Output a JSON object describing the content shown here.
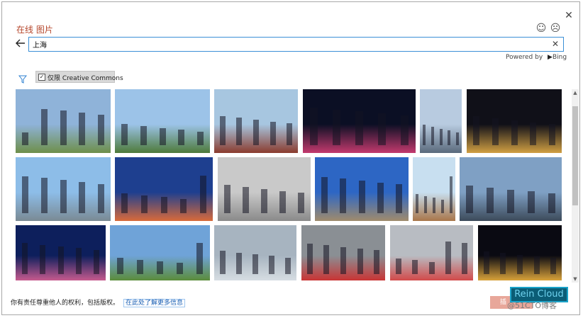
{
  "dialog": {
    "title": "在线 图片",
    "close_icon": "close-icon",
    "feedback_happy_icon": "smiley-icon",
    "feedback_sad_icon": "frown-icon"
  },
  "search": {
    "back_icon": "back-arrow-icon",
    "value": "上海",
    "clear_icon": "clear-icon"
  },
  "powered_by": {
    "label": "Powered by",
    "brand": "Bing"
  },
  "filter": {
    "icon": "filter-icon",
    "creative_commons_label": "仅限 Creative Commons",
    "creative_commons_checked": true
  },
  "results": {
    "items": [
      {
        "name": "disney-castle-photo",
        "colors": [
          "#8fb3d9",
          "#6e8f4a"
        ]
      },
      {
        "name": "disney-castle-photo-2",
        "colors": [
          "#9cc3e8",
          "#4d7a3a"
        ]
      },
      {
        "name": "red-brick-building-photo",
        "colors": [
          "#a7c6e0",
          "#8b3b2e"
        ]
      },
      {
        "name": "night-skyline-photo",
        "colors": [
          "#0b0f24",
          "#c33a6e"
        ]
      },
      {
        "name": "skyscraper-closeup-photo",
        "colors": [
          "#b8cbe0",
          "#5a6a7c"
        ]
      },
      {
        "name": "pearl-tower-night-photo",
        "colors": [
          "#101018",
          "#d1a043"
        ]
      },
      {
        "name": "pudong-skyline-day-photo",
        "colors": [
          "#8dbde8",
          "#7a8a94"
        ]
      },
      {
        "name": "pearl-tower-dusk-photo",
        "colors": [
          "#1e3f8f",
          "#d86a3a"
        ]
      },
      {
        "name": "metro-train-photo",
        "colors": [
          "#c9c9c9",
          "#8a8a8a"
        ]
      },
      {
        "name": "bund-building-photo",
        "colors": [
          "#2d66c4",
          "#a08b6c"
        ]
      },
      {
        "name": "clock-tower-photo",
        "colors": [
          "#c8dff0",
          "#a9764a"
        ]
      },
      {
        "name": "pudong-skyline-cloudy-photo",
        "colors": [
          "#7fa0c4",
          "#3c4a5a"
        ]
      },
      {
        "name": "skyline-night-blue-photo",
        "colors": [
          "#0d1f5c",
          "#c65a8e"
        ]
      },
      {
        "name": "stadium-photo",
        "colors": [
          "#6fa3d8",
          "#5b8c3a"
        ]
      },
      {
        "name": "metro-train-platform-photo",
        "colors": [
          "#a7b4c0",
          "#d6dde2"
        ]
      },
      {
        "name": "red-metro-train-photo",
        "colors": [
          "#8a8f94",
          "#c93434"
        ]
      },
      {
        "name": "metro-station-photo",
        "colors": [
          "#b8bcc2",
          "#d24a4a"
        ]
      },
      {
        "name": "bund-night-photo",
        "colors": [
          "#0a0a12",
          "#d9a23a"
        ]
      },
      {
        "name": "partial-photo-1",
        "colors": [
          "#e0e4ea",
          "#c9d3de"
        ]
      },
      {
        "name": "partial-photo-2",
        "colors": [
          "#dcdcdc",
          "#bcbcbc"
        ]
      },
      {
        "name": "partial-photo-3",
        "colors": [
          "#d7e8f6",
          "#aac6e0"
        ]
      },
      {
        "name": "partial-photo-4",
        "colors": [
          "#cfe0ef",
          "#9bb8d6"
        ]
      },
      {
        "name": "partial-photo-5",
        "colors": [
          "#3a6cc8",
          "#3a6cc8"
        ]
      },
      {
        "name": "partial-photo-6",
        "colors": [
          "#d8d2c8",
          "#b9b1a4"
        ]
      }
    ],
    "selected_index": 7
  },
  "footer": {
    "notice": "你有责任尊重他人的权利，包括版权。",
    "learn_more": "在此处了解更多信息",
    "insert_label": "插"
  },
  "watermark": {
    "logo": "Rein Cloud",
    "text": "@51CTO博客"
  },
  "colors": {
    "accent": "#3b8fd6",
    "title": "#b5462b",
    "insert_disabled": "#e8a79a"
  }
}
